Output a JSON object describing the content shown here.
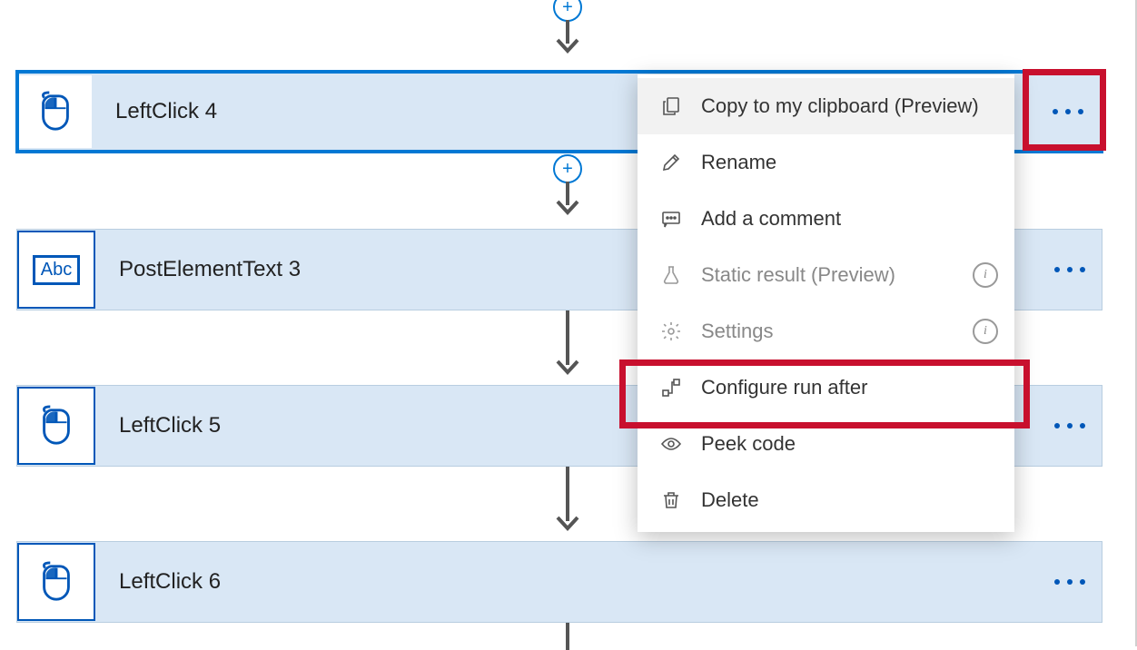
{
  "steps": [
    {
      "label": "LeftClick 4",
      "icon": "mouse"
    },
    {
      "label": "PostElementText 3",
      "icon": "abc"
    },
    {
      "label": "LeftClick 5",
      "icon": "mouse"
    },
    {
      "label": "LeftClick 6",
      "icon": "mouse"
    }
  ],
  "abc_text": "Abc",
  "menu": {
    "copy": "Copy to my clipboard (Preview)",
    "rename": "Rename",
    "comment": "Add a comment",
    "static": "Static result (Preview)",
    "settings": "Settings",
    "configure": "Configure run after",
    "peek": "Peek code",
    "delete": "Delete"
  }
}
